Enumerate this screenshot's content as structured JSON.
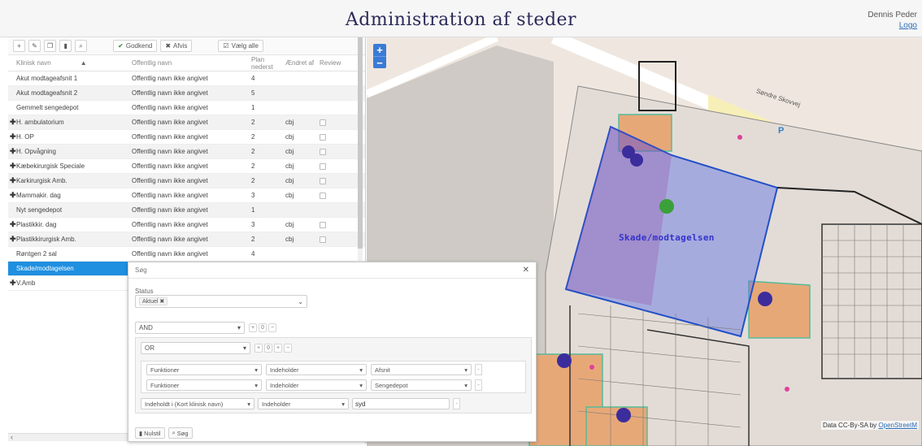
{
  "header": {
    "title": "Administration af steder",
    "user_name": "Dennis Peder",
    "logout": "Logo"
  },
  "toolbar": {
    "approve": "Godkend",
    "reject": "Afvis",
    "select_all": "Vælg alle"
  },
  "grid": {
    "columns": [
      "Klinisk navn",
      "Offentlig navn",
      "Plan nederst",
      "Ændret af",
      "Review"
    ],
    "rows": [
      {
        "expandable": false,
        "clinical": "Akut modtageafsnit 1",
        "public": "Offentlig navn ikke angivet",
        "plan": "4",
        "changed": "",
        "review": false
      },
      {
        "expandable": false,
        "clinical": "Akut modtageafsnit 2",
        "public": "Offentlig navn ikke angivet",
        "plan": "5",
        "changed": "",
        "review": false
      },
      {
        "expandable": false,
        "clinical": "Gemmelt sengedepot",
        "public": "Offentlig navn ikke angivet",
        "plan": "1",
        "changed": "",
        "review": false
      },
      {
        "expandable": true,
        "clinical": "H. ambulatorium",
        "public": "Offentlig navn ikke angivet",
        "plan": "2",
        "changed": "cbj",
        "review": true
      },
      {
        "expandable": true,
        "clinical": "H. OP",
        "public": "Offentlig navn ikke angivet",
        "plan": "2",
        "changed": "cbj",
        "review": true
      },
      {
        "expandable": true,
        "clinical": "H. Opvågning",
        "public": "Offentlig navn ikke angivet",
        "plan": "2",
        "changed": "cbj",
        "review": true
      },
      {
        "expandable": true,
        "clinical": "Kæbekirurgisk Speciale",
        "public": "Offentlig navn ikke angivet",
        "plan": "2",
        "changed": "cbj",
        "review": true
      },
      {
        "expandable": true,
        "clinical": "Karkirurgisk Amb.",
        "public": "Offentlig navn ikke angivet",
        "plan": "2",
        "changed": "cbj",
        "review": true
      },
      {
        "expandable": true,
        "clinical": "Mammakir. dag",
        "public": "Offentlig navn ikke angivet",
        "plan": "3",
        "changed": "cbj",
        "review": true
      },
      {
        "expandable": false,
        "clinical": "Nyt sengedepot",
        "public": "Offentlig navn ikke angivet",
        "plan": "1",
        "changed": "",
        "review": false
      },
      {
        "expandable": true,
        "clinical": "Plastikkir. dag",
        "public": "Offentlig navn ikke angivet",
        "plan": "3",
        "changed": "cbj",
        "review": true
      },
      {
        "expandable": true,
        "clinical": "Plastikkirurgisk Amb.",
        "public": "Offentlig navn ikke angivet",
        "plan": "2",
        "changed": "cbj",
        "review": true
      },
      {
        "expandable": false,
        "clinical": "Røntgen 2 sal",
        "public": "Offentlig navn ikke angivet",
        "plan": "4",
        "changed": "",
        "review": false
      },
      {
        "expandable": false,
        "clinical": "Skade/modtagelsen",
        "public": "",
        "plan": "",
        "changed": "",
        "review": false,
        "selected": true
      },
      {
        "expandable": true,
        "clinical": "V.Amb",
        "public": "",
        "plan": "",
        "changed": "",
        "review": false
      }
    ]
  },
  "search_dialog": {
    "title": "Søg",
    "status_label": "Status",
    "status_tag": "Aktuel",
    "op_and": "AND",
    "op_or": "OR",
    "counter_and": "0",
    "counter_or": "0",
    "filters": [
      {
        "field": "Funktioner",
        "operator": "Indeholder",
        "value": "Afsnit"
      },
      {
        "field": "Funktioner",
        "operator": "Indeholder",
        "value": "Sengedepot"
      }
    ],
    "text_filter": {
      "field": "Indeholdt i (Kort klinisk navn)",
      "operator": "Indeholder",
      "value": "syd"
    },
    "reset": "Nulstil",
    "search": "Søg"
  },
  "map": {
    "highlight_label": "Skade/modtagelsen",
    "road_label": "Søndre Skovvej",
    "parking_symbol": "P",
    "attribution": "Data CC-By-SA by",
    "attribution_link": "OpenStreetM"
  }
}
